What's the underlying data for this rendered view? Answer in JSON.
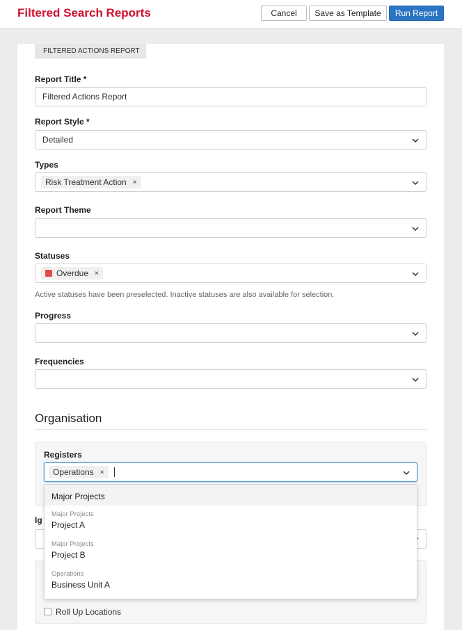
{
  "header": {
    "title": "Filtered Search Reports",
    "cancel_label": "Cancel",
    "save_template_label": "Save as Template",
    "run_label": "Run Report",
    "accent_color": "#d0102e",
    "primary_color": "#2b74c4"
  },
  "tab": {
    "label": "FILTERED ACTIONS REPORT"
  },
  "form": {
    "report_title": {
      "label": "Report Title *",
      "value": "Filtered Actions Report"
    },
    "report_style": {
      "label": "Report Style *",
      "value": "Detailed"
    },
    "types": {
      "label": "Types",
      "chips": [
        "Risk Treatment Action"
      ]
    },
    "report_theme": {
      "label": "Report Theme",
      "value": ""
    },
    "statuses": {
      "label": "Statuses",
      "chips": [
        "Overdue"
      ],
      "status_color": "#e04b4b",
      "hint": "Active statuses have been preselected. Inactive statuses are also available for selection."
    },
    "progress": {
      "label": "Progress",
      "value": ""
    },
    "frequencies": {
      "label": "Frequencies",
      "value": ""
    }
  },
  "organisation": {
    "title": "Organisation",
    "registers": {
      "label": "Registers",
      "chips": [
        "Operations"
      ],
      "options": [
        {
          "group": "",
          "name": "Major Projects"
        },
        {
          "group": "Major Projects",
          "name": "Project A"
        },
        {
          "group": "Major Projects",
          "name": "Project B"
        },
        {
          "group": "Operations",
          "name": "Business Unit A"
        }
      ]
    },
    "partial_label": "Ig",
    "roll_up_label": "Roll Up Locations"
  },
  "icons": {
    "chevron": "chevron-down-icon",
    "remove": "remove-x-icon",
    "checkbox": "checkbox-icon"
  }
}
